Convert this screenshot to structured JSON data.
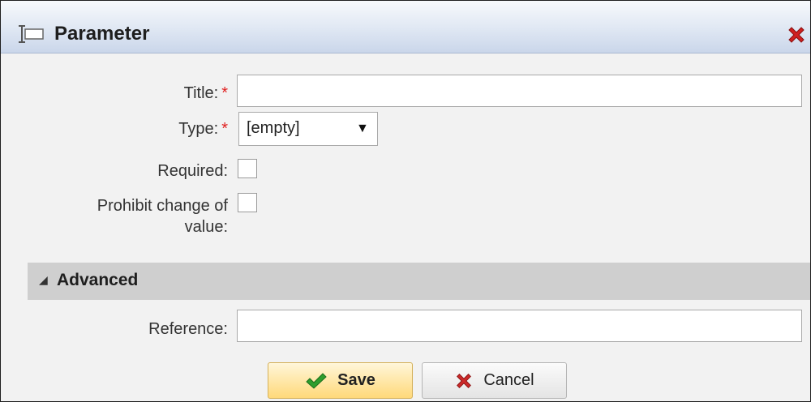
{
  "dialog": {
    "title": "Parameter",
    "icons": {
      "title": "parameter-icon",
      "close": "close-icon"
    }
  },
  "form": {
    "title": {
      "label": "Title:",
      "required_mark": "*",
      "value": ""
    },
    "type": {
      "label": "Type:",
      "required_mark": "*",
      "selected": "[empty]",
      "arrow": "▼"
    },
    "required": {
      "label": "Required:",
      "checked": false
    },
    "prohibit_change": {
      "label_line1": "Prohibit change of",
      "label_line2": "value:",
      "checked": false
    }
  },
  "advanced": {
    "toggle_glyph": "◢",
    "label": "Advanced",
    "reference": {
      "label": "Reference:",
      "value": ""
    }
  },
  "buttons": {
    "save": {
      "label": "Save",
      "icon": "checkmark-icon"
    },
    "cancel": {
      "label": "Cancel",
      "icon": "cancel-x-icon"
    }
  },
  "colors": {
    "required_mark": "#e02020",
    "close_icon": "#d02020",
    "save_icon": "#2e9e2e",
    "cancel_icon": "#cc2a2a",
    "save_button": "#ffd97a",
    "section_bar": "#cfcfcf"
  }
}
